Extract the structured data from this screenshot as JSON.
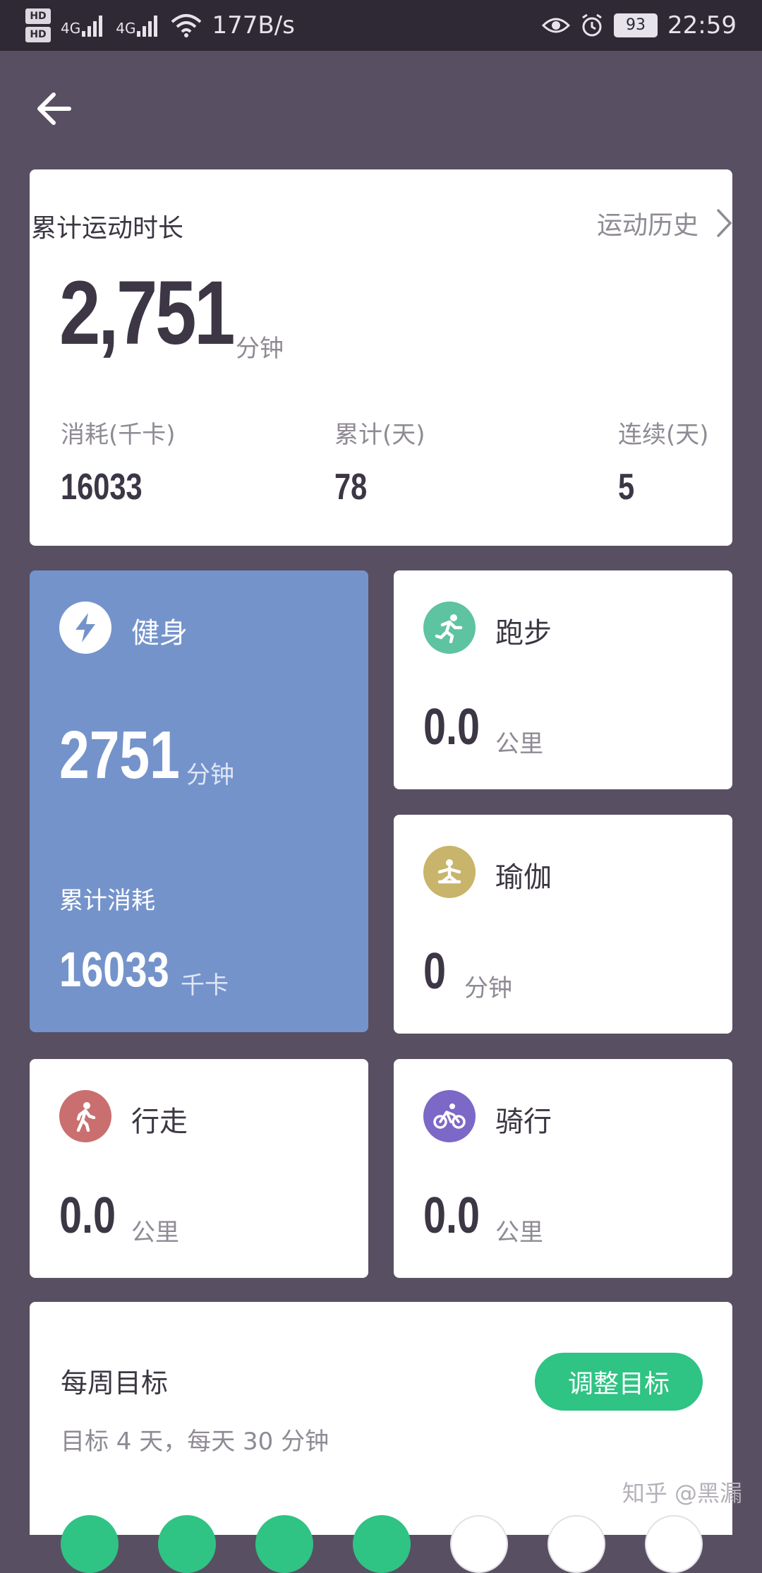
{
  "status_bar": {
    "hd1": "HD",
    "hd2": "HD",
    "signal1": "4G",
    "signal2": "4G",
    "net_speed": "177B/s",
    "battery": "93",
    "time": "22:59"
  },
  "summary": {
    "title": "累计运动时长",
    "history_link": "运动历史",
    "total_minutes": "2,751",
    "total_unit": "分钟",
    "stats": [
      {
        "label": "消耗(千卡)",
        "value": "16033"
      },
      {
        "label": "累计(天)",
        "value": "78"
      },
      {
        "label": "连续(天)",
        "value": "5"
      }
    ]
  },
  "tiles": {
    "fitness": {
      "name": "健身",
      "value": "2751",
      "unit": "分钟",
      "sub_label": "累计消耗",
      "calories": "16033",
      "calories_unit": "千卡",
      "color": "#7593cb"
    },
    "running": {
      "name": "跑步",
      "value": "0.0",
      "unit": "公里",
      "icon_color": "#5ec3a0"
    },
    "yoga": {
      "name": "瑜伽",
      "value": "0",
      "unit": "分钟",
      "icon_color": "#c8b46a"
    },
    "walking": {
      "name": "行走",
      "value": "0.0",
      "unit": "公里",
      "icon_color": "#c96f6f"
    },
    "cycling": {
      "name": "骑行",
      "value": "0.0",
      "unit": "公里",
      "icon_color": "#7c68c7"
    }
  },
  "weekly_goal": {
    "title": "每周目标",
    "description": "目标 4 天，每天 30 分钟",
    "button": "调整目标",
    "days_completed": 4,
    "days_total": 7,
    "accent": "#2fc384"
  },
  "watermark": "知乎 @黑漏"
}
